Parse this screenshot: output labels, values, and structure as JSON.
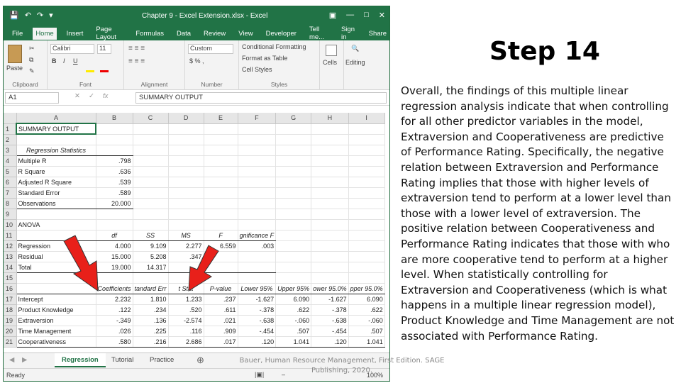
{
  "excel": {
    "title": "Chapter 9 - Excel Extension.xlsx - Excel",
    "tabs": [
      "File",
      "Home",
      "Insert",
      "Page Layout",
      "Formulas",
      "Data",
      "Review",
      "View",
      "Developer",
      "Tell me...",
      "Sign in",
      "Share"
    ],
    "ribbon": {
      "paste_label": "Paste",
      "clipboard_group": "Clipboard",
      "font_name": "Calibri",
      "font_size": "11",
      "font_group": "Font",
      "alignment_group": "Alignment",
      "number_format": "Custom",
      "number_group": "Number",
      "conditional_formatting": "Conditional Formatting",
      "format_as_table": "Format as Table",
      "cell_styles": "Cell Styles",
      "styles_group": "Styles",
      "cells_label": "Cells",
      "editing_label": "Editing"
    },
    "name_box": "A1",
    "formula_content": "SUMMARY OUTPUT",
    "columns": [
      "A",
      "B",
      "C",
      "D",
      "E",
      "F",
      "G",
      "H",
      "I"
    ],
    "rows": [
      {
        "n": "1",
        "cells": [
          "SUMMARY OUTPUT",
          "",
          "",
          "",
          "",
          "",
          "",
          "",
          ""
        ]
      },
      {
        "n": "2",
        "cells": [
          "",
          "",
          "",
          "",
          "",
          "",
          "",
          "",
          ""
        ]
      },
      {
        "n": "3",
        "cells": [
          "Regression Statistics",
          "",
          "",
          "",
          "",
          "",
          "",
          "",
          ""
        ]
      },
      {
        "n": "4",
        "cells": [
          "Multiple R",
          ".798",
          "",
          "",
          "",
          "",
          "",
          "",
          ""
        ]
      },
      {
        "n": "5",
        "cells": [
          "R Square",
          ".636",
          "",
          "",
          "",
          "",
          "",
          "",
          ""
        ]
      },
      {
        "n": "6",
        "cells": [
          "Adjusted R Square",
          ".539",
          "",
          "",
          "",
          "",
          "",
          "",
          ""
        ]
      },
      {
        "n": "7",
        "cells": [
          "Standard Error",
          ".589",
          "",
          "",
          "",
          "",
          "",
          "",
          ""
        ]
      },
      {
        "n": "8",
        "cells": [
          "Observations",
          "20.000",
          "",
          "",
          "",
          "",
          "",
          "",
          ""
        ]
      },
      {
        "n": "9",
        "cells": [
          "",
          "",
          "",
          "",
          "",
          "",
          "",
          "",
          ""
        ]
      },
      {
        "n": "10",
        "cells": [
          "ANOVA",
          "",
          "",
          "",
          "",
          "",
          "",
          "",
          ""
        ]
      },
      {
        "n": "11",
        "cells": [
          "",
          "df",
          "SS",
          "MS",
          "F",
          "gnificance F",
          "",
          "",
          ""
        ]
      },
      {
        "n": "12",
        "cells": [
          "Regression",
          "4.000",
          "9.109",
          "2.277",
          "6.559",
          ".003",
          "",
          "",
          ""
        ]
      },
      {
        "n": "13",
        "cells": [
          "Residual",
          "15.000",
          "5.208",
          ".347",
          "",
          "",
          "",
          "",
          ""
        ]
      },
      {
        "n": "14",
        "cells": [
          "Total",
          "19.000",
          "14.317",
          "",
          "",
          "",
          "",
          "",
          ""
        ]
      },
      {
        "n": "15",
        "cells": [
          "",
          "",
          "",
          "",
          "",
          "",
          "",
          "",
          ""
        ]
      },
      {
        "n": "16",
        "cells": [
          "",
          "Coefficients",
          "tandard Err",
          "t Stat",
          "P-value",
          "Lower 95%",
          "Upper 95%",
          "ower 95.0%",
          "pper 95.0%"
        ]
      },
      {
        "n": "17",
        "cells": [
          "Intercept",
          "2.232",
          "1.810",
          "1.233",
          ".237",
          "-1.627",
          "6.090",
          "-1.627",
          "6.090"
        ]
      },
      {
        "n": "18",
        "cells": [
          "Product Knowledge",
          ".122",
          ".234",
          ".520",
          ".611",
          "-.378",
          ".622",
          "-.378",
          ".622"
        ]
      },
      {
        "n": "19",
        "cells": [
          "Extraversion",
          "-.349",
          ".136",
          "-2.574",
          ".021",
          "-.638",
          "-.060",
          "-.638",
          "-.060"
        ]
      },
      {
        "n": "20",
        "cells": [
          "Time Management",
          ".026",
          ".225",
          ".116",
          ".909",
          "-.454",
          ".507",
          "-.454",
          ".507"
        ]
      },
      {
        "n": "21",
        "cells": [
          "Cooperativeness",
          ".580",
          ".216",
          "2.686",
          ".017",
          ".120",
          "1.041",
          ".120",
          "1.041"
        ]
      }
    ],
    "sheet_tabs": [
      "Regression",
      "Tutorial",
      "Practice"
    ],
    "status": "Ready",
    "zoom": "100%"
  },
  "slide": {
    "title": "Step 14",
    "body": "Overall, the findings of this multiple linear regression analysis indicate that when controlling for all other predictor variables in the model, Extraversion and Cooperativeness are predictive of Performance Rating. Specifically, the negative relation between Extraversion and Performance Rating implies that those with higher levels of extraversion tend to perform at a lower level than those with a lower level of extraversion. The positive relation between Cooperativeness and Performance Rating indicates that those with who are more cooperative tend to perform at a higher level. When statistically controlling for Extraversion and Cooperativeness (which is what happens in a multiple linear regression model), Product Knowledge and Time Management are not associated with Performance Rating.",
    "citation_line1": "Bauer, Human Resource Management, First Edition. SAGE",
    "citation_line2": "Publishing, 2020."
  },
  "colors": {
    "excel_green": "#217346",
    "arrow_red": "#e8201a"
  }
}
